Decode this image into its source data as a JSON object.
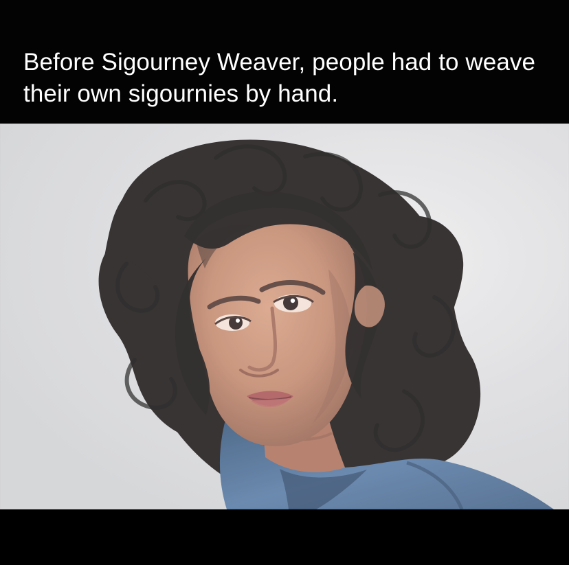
{
  "meme": {
    "caption": "Before Sigourney Weaver, people had to weave their own sigournies by hand.",
    "colors": {
      "background": "#000000",
      "caption_text": "#ffffff",
      "photo_background": "#dcdcdf",
      "hair": "#100b0a",
      "skin": "#c98f73",
      "shirt": "#4f74a0"
    },
    "photo": {
      "subject": "portrait-photo-woman-dark-curly-hair-blue-shirt"
    }
  }
}
